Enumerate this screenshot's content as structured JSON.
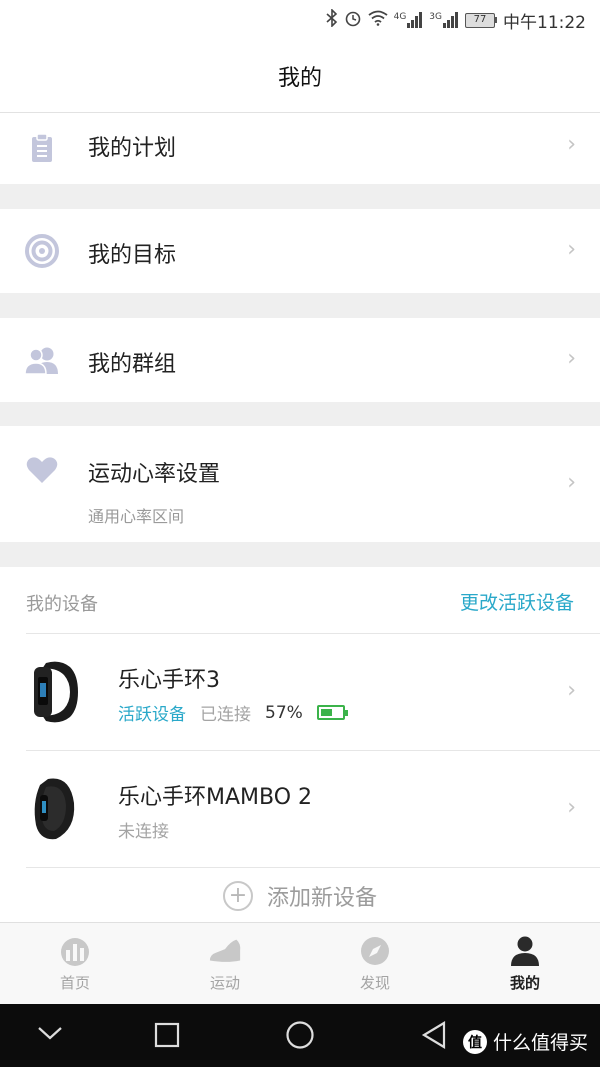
{
  "status_bar": {
    "net1": "4G",
    "net2": "3G",
    "battery": "77",
    "time": "中午11:22"
  },
  "header": {
    "title": "我的"
  },
  "menu": {
    "plan": {
      "label": "我的计划",
      "icon": "clipboard-icon"
    },
    "goal": {
      "label": "我的目标",
      "icon": "target-icon"
    },
    "group": {
      "label": "我的群组",
      "icon": "group-icon"
    },
    "heart": {
      "label": "运动心率设置",
      "sub": "通用心率区间",
      "icon": "heart-icon"
    }
  },
  "devices": {
    "title": "我的设备",
    "action": "更改活跃设备",
    "items": [
      {
        "name": "乐心手环3",
        "status_active": "活跃设备",
        "status": "已连接",
        "battery_pct": "57%",
        "battery_level": 0.57
      },
      {
        "name": "乐心手环MAMBO 2",
        "status": "未连接"
      }
    ],
    "add_label": "添加新设备"
  },
  "tabs": [
    {
      "label": "首页",
      "icon": "chart-icon",
      "active": false
    },
    {
      "label": "运动",
      "icon": "shoe-icon",
      "active": false
    },
    {
      "label": "发现",
      "icon": "compass-icon",
      "active": false
    },
    {
      "label": "我的",
      "icon": "user-icon",
      "active": true
    }
  ],
  "watermark": {
    "text": "什么值得买",
    "logo": "值"
  },
  "colors": {
    "accent": "#29a8c9",
    "battery_green": "#3bb34a",
    "icon_lilac": "#c3c6dc"
  }
}
